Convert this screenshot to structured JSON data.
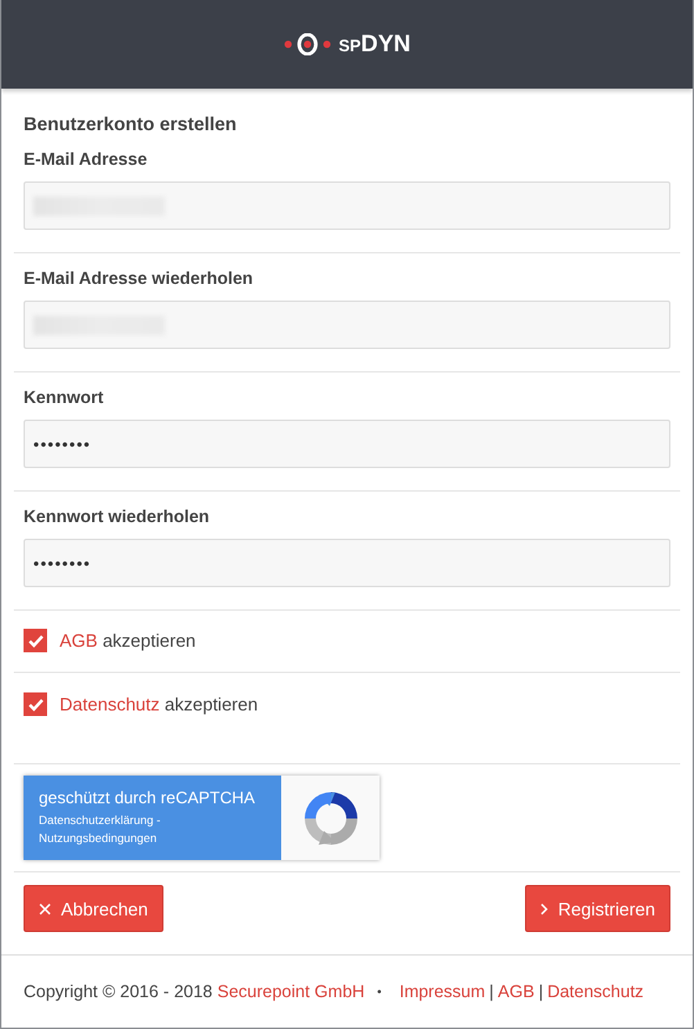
{
  "header": {
    "logo": {
      "prefix": "SP",
      "name": "DYN"
    }
  },
  "form": {
    "title": "Benutzerkonto erstellen",
    "fields": [
      {
        "label": "E-Mail Adresse",
        "kind": "redacted"
      },
      {
        "label": "E-Mail Adresse wiederholen",
        "kind": "redacted"
      },
      {
        "label": "Kennwort",
        "kind": "password",
        "value": "••••••••"
      },
      {
        "label": "Kennwort wiederholen",
        "kind": "password",
        "value": "••••••••"
      }
    ],
    "checkboxes": [
      {
        "link": "AGB",
        "text": "akzeptieren",
        "checked": true
      },
      {
        "link": "Datenschutz",
        "text": "akzeptieren",
        "checked": true
      }
    ],
    "recaptcha": {
      "title": "geschützt durch reCAPTCHA",
      "links": [
        "Datenschutzerklärung -",
        "Nutzungsbedingungen"
      ]
    },
    "buttons": [
      {
        "kind": "cancel",
        "label": "Abbrechen"
      },
      {
        "kind": "submit",
        "label": "Registrieren"
      }
    ]
  },
  "footer": {
    "copyright": "Copyright © 2016 - 2018",
    "company": "Securepoint GmbH",
    "separator": "•",
    "links": [
      "Impressum",
      "AGB",
      "Datenschutz"
    ],
    "divider": "|"
  }
}
